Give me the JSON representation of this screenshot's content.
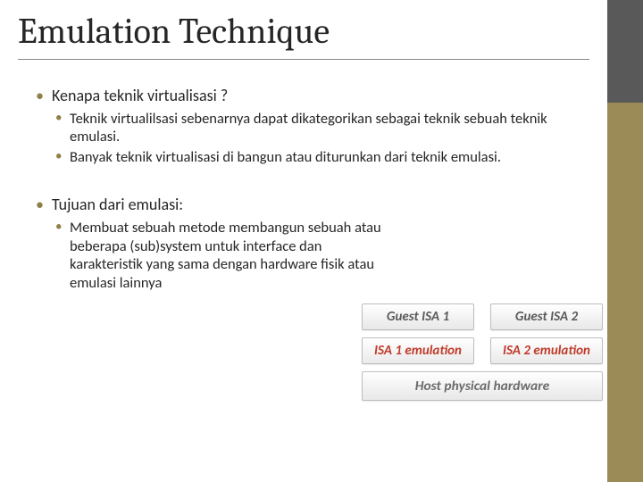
{
  "title": "Emulation Technique",
  "section1": {
    "heading": "Kenapa teknik virtualisasi ?",
    "items": [
      "Teknik virtualilsasi sebenarnya dapat dikategorikan sebagai teknik sebuah teknik emulasi.",
      "Banyak teknik virtualisasi di bangun atau diturunkan dari teknik emulasi."
    ]
  },
  "section2": {
    "heading": "Tujuan dari emulasi:",
    "items": [
      "Membuat sebuah metode membangun sebuah atau beberapa (sub)system untuk interface dan karakteristik yang sama dengan hardware fisik atau emulasi lainnya"
    ]
  },
  "diagram": {
    "guest1": "Guest ISA 1",
    "guest2": "Guest ISA 2",
    "emul1": "ISA 1 emulation",
    "emul2": "ISA 2 emulation",
    "host": "Host physical hardware"
  }
}
